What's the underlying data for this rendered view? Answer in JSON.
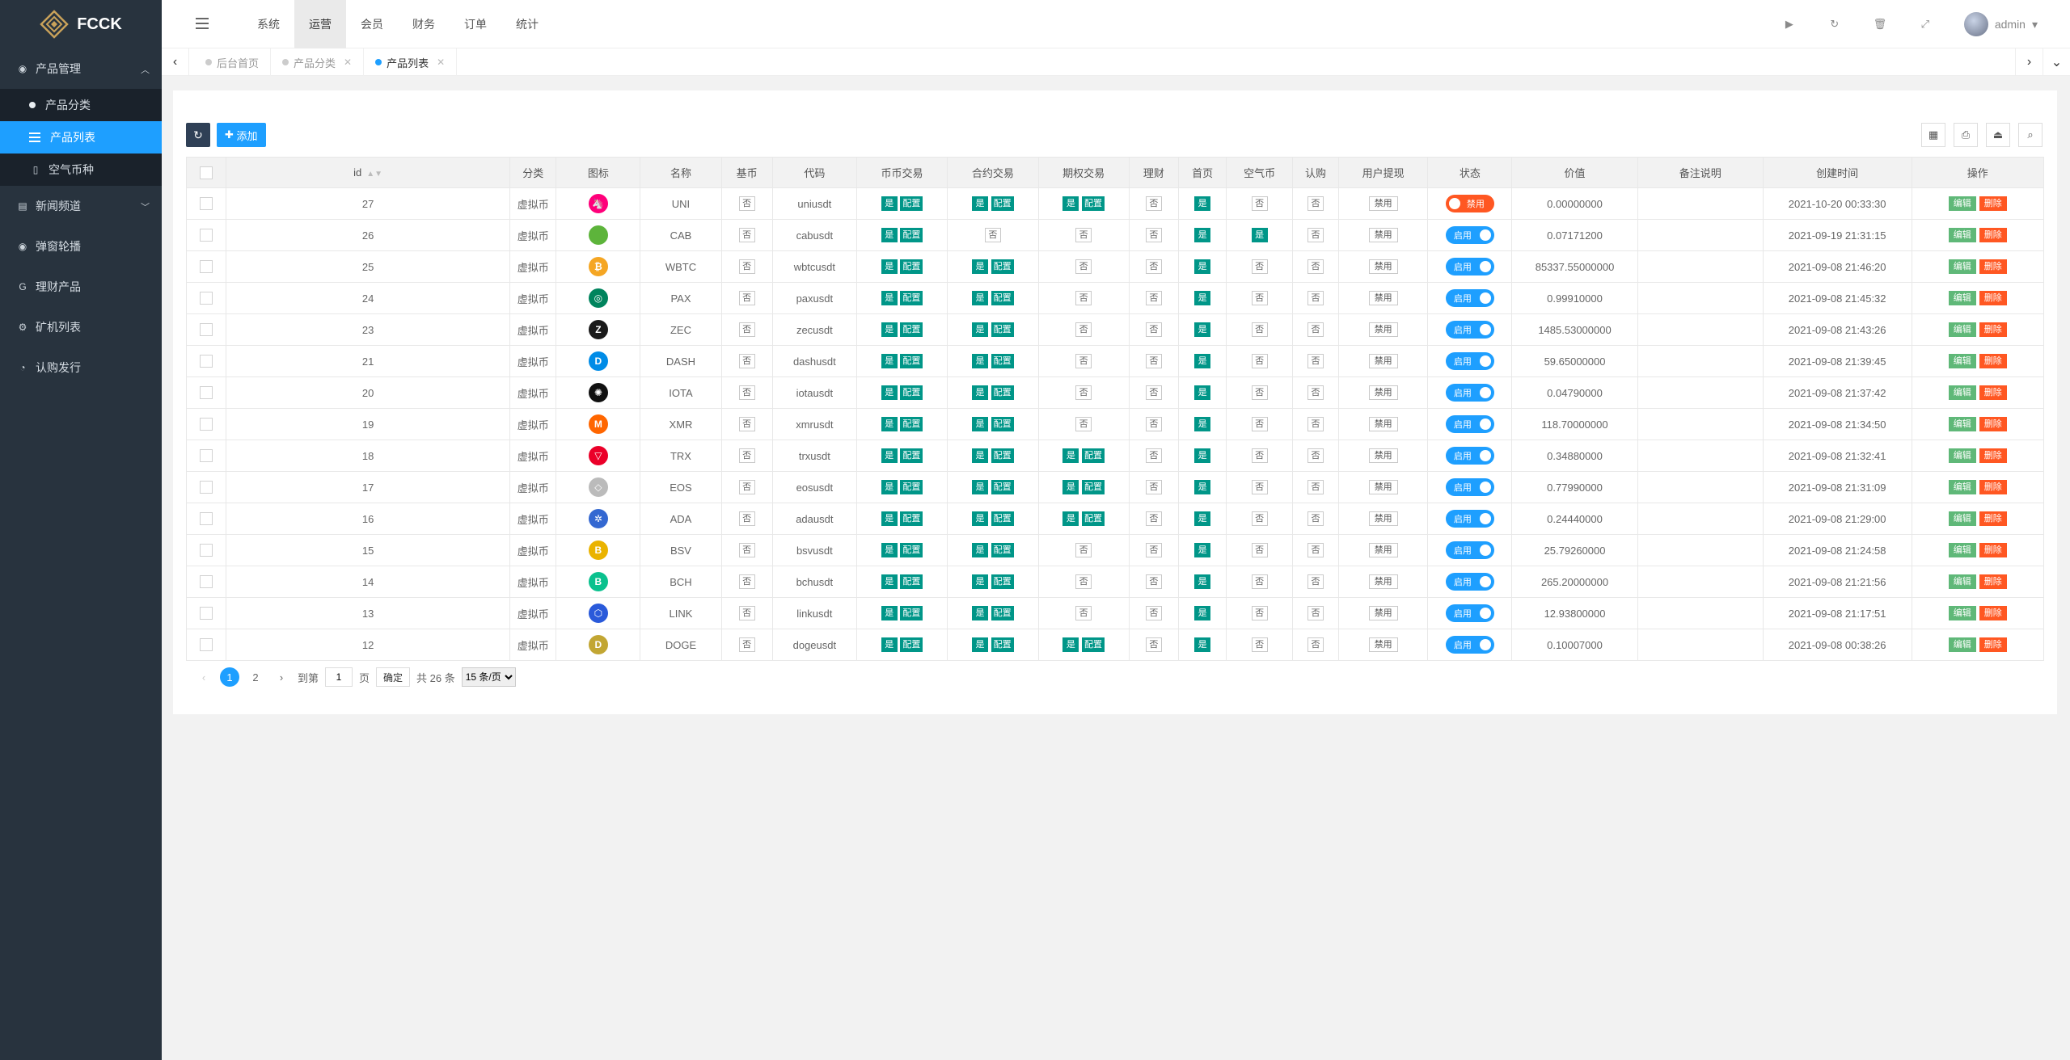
{
  "app": {
    "brand": "FCCK"
  },
  "sidebar": {
    "groups": [
      {
        "label": "产品管理",
        "icon": "product-icon",
        "expanded": true,
        "children": [
          {
            "label": "产品分类",
            "active": false
          },
          {
            "label": "产品列表",
            "active": true
          },
          {
            "label": "空气币种",
            "active": false
          }
        ]
      },
      {
        "label": "新闻频道",
        "icon": "news-icon"
      },
      {
        "label": "弹窗轮播",
        "icon": "carousel-icon"
      },
      {
        "label": "理财产品",
        "icon": "finance-icon"
      },
      {
        "label": "矿机列表",
        "icon": "miner-icon"
      },
      {
        "label": "认购发行",
        "icon": "subscribe-icon"
      }
    ]
  },
  "header": {
    "tabs": [
      "系统",
      "运营",
      "会员",
      "财务",
      "订单",
      "统计"
    ],
    "active_tab": "运营",
    "user": "admin"
  },
  "page_tabs": [
    {
      "label": "后台首页",
      "closable": false,
      "active": false
    },
    {
      "label": "产品分类",
      "closable": true,
      "active": false
    },
    {
      "label": "产品列表",
      "closable": true,
      "active": true
    }
  ],
  "toolbar": {
    "add_label": "添加"
  },
  "table": {
    "columns": [
      "id",
      "分类",
      "图标",
      "名称",
      "基币",
      "代码",
      "币币交易",
      "合约交易",
      "期权交易",
      "理财",
      "首页",
      "空气币",
      "认购",
      "用户提现",
      "状态",
      "价值",
      "备注说明",
      "创建时间",
      "操作"
    ],
    "labels": {
      "yes": "是",
      "no": "否",
      "config": "配置",
      "ban": "禁用",
      "on": "启用",
      "off": "禁用",
      "edit": "编辑",
      "delete": "删除"
    },
    "rows": [
      {
        "id": "27",
        "cat": "虚拟币",
        "name": "UNI",
        "code": "uniusdt",
        "spot": true,
        "contract": true,
        "option": true,
        "home": true,
        "air": false,
        "status": "off",
        "value": "0.00000000",
        "created": "2021-10-20 00:33:30",
        "icon_color": "#ff007a",
        "icon_char": "🦄"
      },
      {
        "id": "26",
        "cat": "虚拟币",
        "name": "CAB",
        "code": "cabusdt",
        "spot": true,
        "contract": false,
        "option": false,
        "home": true,
        "air": true,
        "status": "on",
        "value": "0.07171200",
        "created": "2021-09-19 21:31:15",
        "icon_color": "#5db43b",
        "icon_char": ""
      },
      {
        "id": "25",
        "cat": "虚拟币",
        "name": "WBTC",
        "code": "wbtcusdt",
        "spot": true,
        "contract": true,
        "option": false,
        "home": true,
        "air": false,
        "status": "on",
        "value": "85337.55000000",
        "created": "2021-09-08 21:46:20",
        "icon_color": "#f5a623",
        "icon_char": "₿"
      },
      {
        "id": "24",
        "cat": "虚拟币",
        "name": "PAX",
        "code": "paxusdt",
        "spot": true,
        "contract": true,
        "option": false,
        "home": true,
        "air": false,
        "status": "on",
        "value": "0.99910000",
        "created": "2021-09-08 21:45:32",
        "icon_color": "#00845d",
        "icon_char": "◎"
      },
      {
        "id": "23",
        "cat": "虚拟币",
        "name": "ZEC",
        "code": "zecusdt",
        "spot": true,
        "contract": true,
        "option": false,
        "home": true,
        "air": false,
        "status": "on",
        "value": "1485.53000000",
        "created": "2021-09-08 21:43:26",
        "icon_color": "#1a1a1a",
        "icon_char": "Z"
      },
      {
        "id": "21",
        "cat": "虚拟币",
        "name": "DASH",
        "code": "dashusdt",
        "spot": true,
        "contract": true,
        "option": false,
        "home": true,
        "air": false,
        "status": "on",
        "value": "59.65000000",
        "created": "2021-09-08 21:39:45",
        "icon_color": "#008ce7",
        "icon_char": "D"
      },
      {
        "id": "20",
        "cat": "虚拟币",
        "name": "IOTA",
        "code": "iotausdt",
        "spot": true,
        "contract": true,
        "option": false,
        "home": true,
        "air": false,
        "status": "on",
        "value": "0.04790000",
        "created": "2021-09-08 21:37:42",
        "icon_color": "#111111",
        "icon_char": "✺"
      },
      {
        "id": "19",
        "cat": "虚拟币",
        "name": "XMR",
        "code": "xmrusdt",
        "spot": true,
        "contract": true,
        "option": false,
        "home": true,
        "air": false,
        "status": "on",
        "value": "118.70000000",
        "created": "2021-09-08 21:34:50",
        "icon_color": "#ff6600",
        "icon_char": "M"
      },
      {
        "id": "18",
        "cat": "虚拟币",
        "name": "TRX",
        "code": "trxusdt",
        "spot": true,
        "contract": true,
        "option": true,
        "home": true,
        "air": false,
        "status": "on",
        "value": "0.34880000",
        "created": "2021-09-08 21:32:41",
        "icon_color": "#eb0029",
        "icon_char": "▽"
      },
      {
        "id": "17",
        "cat": "虚拟币",
        "name": "EOS",
        "code": "eosusdt",
        "spot": true,
        "contract": true,
        "option": true,
        "home": true,
        "air": false,
        "status": "on",
        "value": "0.77990000",
        "created": "2021-09-08 21:31:09",
        "icon_color": "#bbbbbb",
        "icon_char": "◇"
      },
      {
        "id": "16",
        "cat": "虚拟币",
        "name": "ADA",
        "code": "adausdt",
        "spot": true,
        "contract": true,
        "option": true,
        "home": true,
        "air": false,
        "status": "on",
        "value": "0.24440000",
        "created": "2021-09-08 21:29:00",
        "icon_color": "#3468d1",
        "icon_char": "✲"
      },
      {
        "id": "15",
        "cat": "虚拟币",
        "name": "BSV",
        "code": "bsvusdt",
        "spot": true,
        "contract": true,
        "option": false,
        "home": true,
        "air": false,
        "status": "on",
        "value": "25.79260000",
        "created": "2021-09-08 21:24:58",
        "icon_color": "#eab300",
        "icon_char": "B"
      },
      {
        "id": "14",
        "cat": "虚拟币",
        "name": "BCH",
        "code": "bchusdt",
        "spot": true,
        "contract": true,
        "option": false,
        "home": true,
        "air": false,
        "status": "on",
        "value": "265.20000000",
        "created": "2021-09-08 21:21:56",
        "icon_color": "#0ac18e",
        "icon_char": "B"
      },
      {
        "id": "13",
        "cat": "虚拟币",
        "name": "LINK",
        "code": "linkusdt",
        "spot": true,
        "contract": true,
        "option": false,
        "home": true,
        "air": false,
        "status": "on",
        "value": "12.93800000",
        "created": "2021-09-08 21:17:51",
        "icon_color": "#2a5ada",
        "icon_char": "⬡"
      },
      {
        "id": "12",
        "cat": "虚拟币",
        "name": "DOGE",
        "code": "dogeusdt",
        "spot": true,
        "contract": true,
        "option": true,
        "home": true,
        "air": false,
        "status": "on",
        "value": "0.10007000",
        "created": "2021-09-08 00:38:26",
        "icon_color": "#c2a633",
        "icon_char": "D"
      }
    ]
  },
  "pager": {
    "pages": [
      "1",
      "2"
    ],
    "current": "1",
    "goto_prefix": "到第",
    "goto_value": "1",
    "goto_suffix": "页",
    "confirm": "确定",
    "total": "共 26 条",
    "per_page": "15 条/页"
  }
}
